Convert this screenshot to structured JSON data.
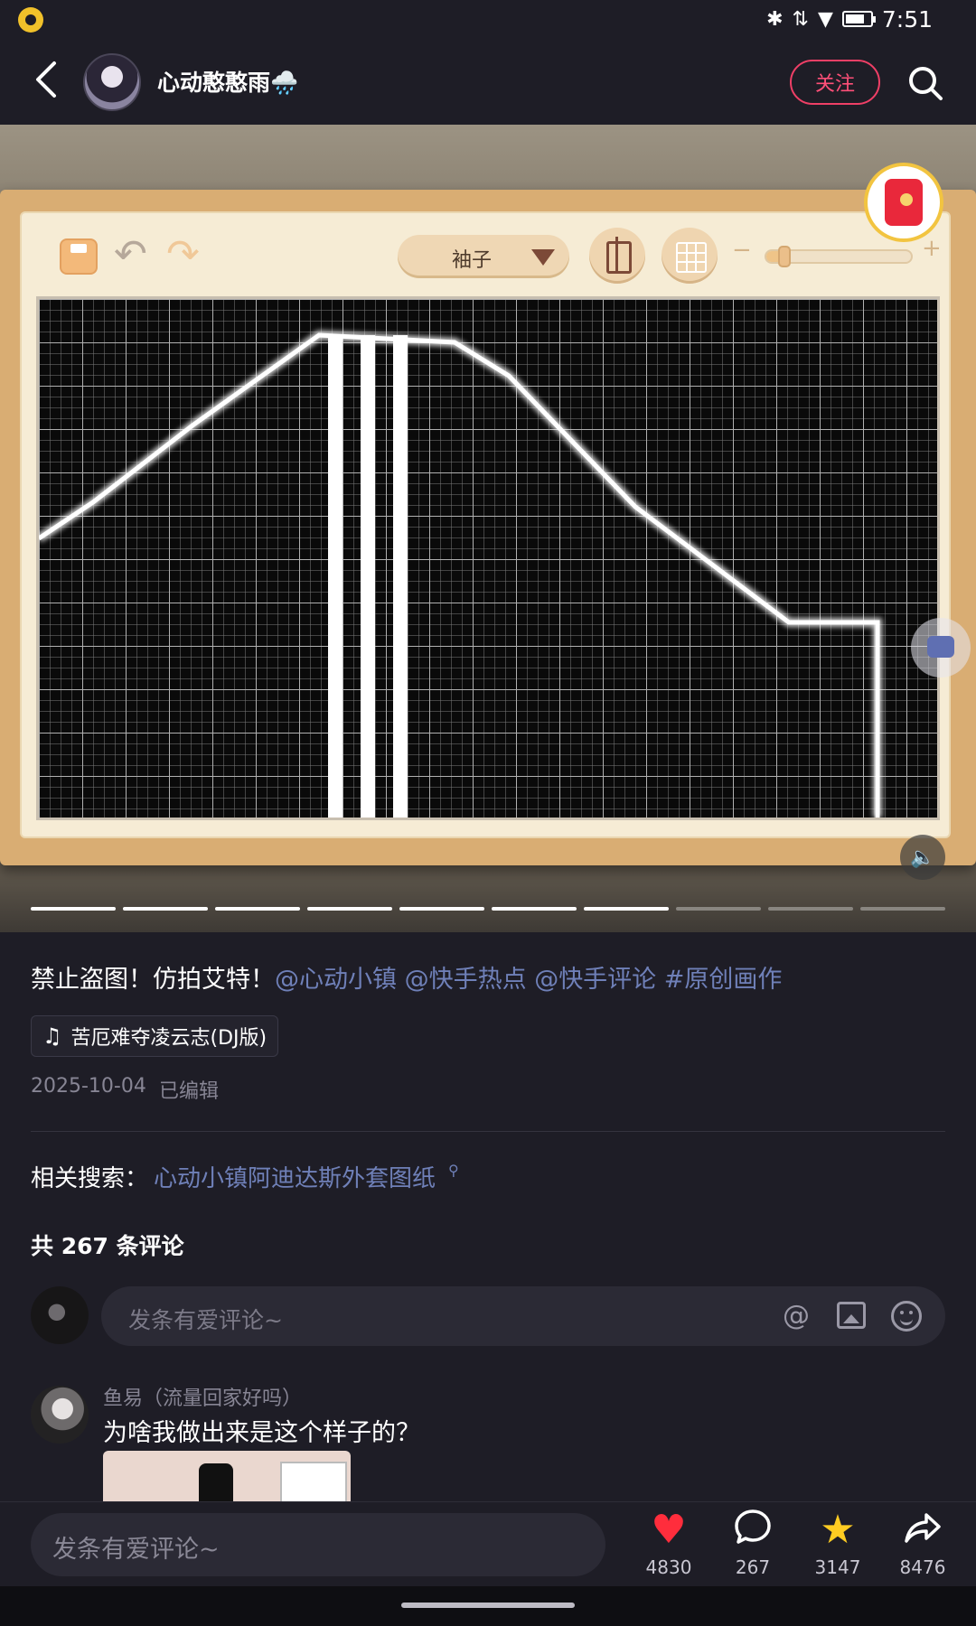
{
  "status_bar": {
    "time": "7:51",
    "icons": [
      "app-notification-icon",
      "bluetooth-icon",
      "signal-icon",
      "wifi-icon",
      "battery-icon"
    ]
  },
  "header": {
    "author_name": "心动憨憨雨🌧️",
    "follow_label": "关注"
  },
  "media": {
    "part_select_label": "袖子",
    "zoom_percent": 12,
    "progress_total": 10,
    "progress_current": 7,
    "canvas_background": "#0a0a0a",
    "canvas_grid_color": "#8c8c8c",
    "drawing_color": "#ffffff"
  },
  "post": {
    "caption_text": "禁止盗图！仿拍艾特！",
    "caption_tags": [
      "@心动小镇",
      "@快手热点",
      "@快手评论",
      "#原创画作"
    ],
    "music_title": "苦厄难夺凌云志(DJ版)",
    "date": "2025-10-04",
    "edited_label": "已编辑",
    "related_label": "相关搜索：",
    "related_link": "心动小镇阿迪达斯外套图纸",
    "comment_count_label": "共 267 条评论"
  },
  "comment_box": {
    "placeholder": "发条有爱评论~"
  },
  "comments": [
    {
      "user": "鱼易（流量回家好吗）",
      "text": "为啥我做出来是这个样子的？"
    }
  ],
  "bottom_bar": {
    "placeholder": "发条有爱评论~",
    "like_count": "4830",
    "comment_count": "267",
    "star_count": "3147",
    "share_count": "8476"
  },
  "colors": {
    "background": "#1e1d26",
    "accent": "#ef3f66",
    "link": "#6f80b8",
    "like": "#ff2d3c",
    "star": "#ffcc22"
  }
}
